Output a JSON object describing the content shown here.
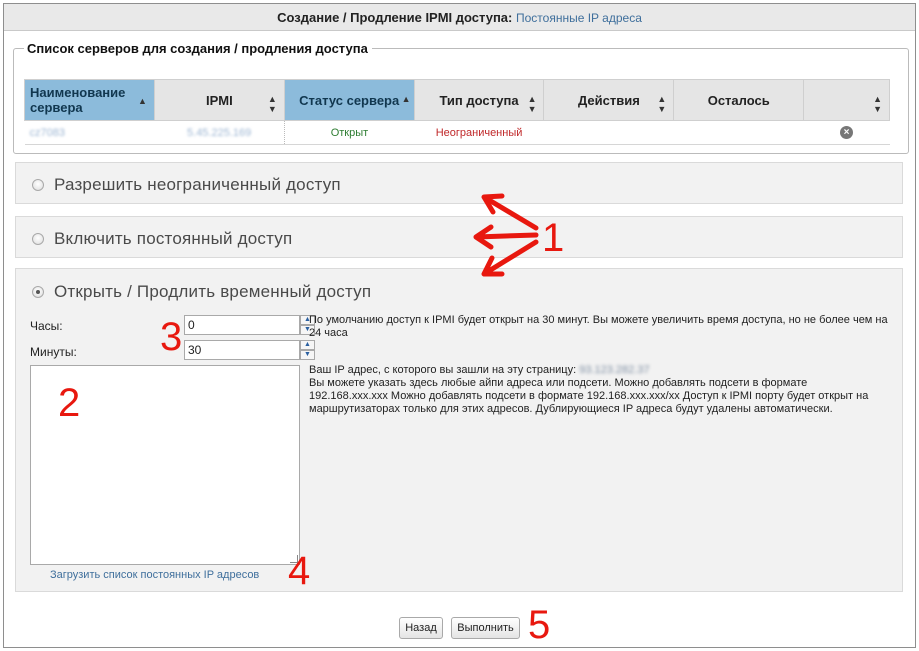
{
  "header": {
    "title": "Создание / Продление IPMI доступа:",
    "link": "Постоянные IP адреса"
  },
  "servers_section": {
    "legend": "Список серверов для создания / продления доступа",
    "columns": [
      "Наименование сервера",
      "IPMI",
      "Статус сервера",
      "Тип доступа",
      "Действия",
      "Осталось",
      ""
    ],
    "rows": [
      {
        "name": "cz7083",
        "ipmi": "5.45.225.169",
        "status": "Открыт",
        "access": "Неограниченный",
        "actions": "",
        "remaining": ""
      }
    ]
  },
  "options": {
    "unlimited": "Разрешить неограниченный доступ",
    "permanent": "Включить постоянный доступ",
    "temporary": "Открыть / Продлить временный доступ"
  },
  "form": {
    "hours_label": "Часы:",
    "hours_value": "0",
    "minutes_label": "Минуты:",
    "minutes_value": "30",
    "load_link": "Загрузить список постоянных IP адресов",
    "help_default": "По умолчанию доступ к IPMI будет открыт на 30 минут. Вы можете увеличить время доступа, но не более чем на 24 часа",
    "your_ip_label": "Ваш IP адрес, с которого вы зашли на эту страницу:",
    "your_ip": "93.123.282.37",
    "help_subnets": "Вы можете указать здесь любые айпи адреса или подсети. Можно добавлять подсети в формате 192.168.xxx.xxx Можно добавлять подсети в формате 192.168.xxx.xxx/xx Доступ к IPMI порту будет открыт на маршрутизаторах только для этих адресов. Дублирующиеся IP адреса будут удалены автоматически."
  },
  "buttons": {
    "back": "Назад",
    "execute": "Выполнить"
  },
  "annotations": {
    "one": "1",
    "two": "2",
    "three": "3",
    "four": "4",
    "five": "5",
    "color": "#e8180f"
  },
  "colors": {
    "active_header": "#8cbbdb",
    "link": "#3f6f9c",
    "status_open": "#2e7d32",
    "access_unlimited": "#c0282a"
  }
}
